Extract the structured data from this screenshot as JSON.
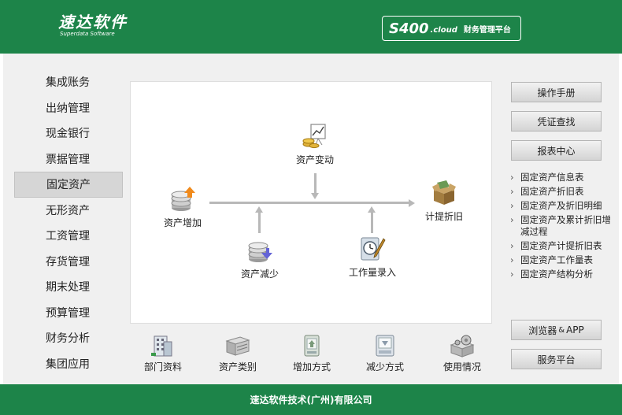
{
  "header": {
    "logo_main": "速达软件",
    "logo_sub": "Superdata Software",
    "product_name": "S400",
    "product_suffix": ".cloud",
    "product_desc": "财务管理平台"
  },
  "nav": {
    "items": [
      {
        "label": "集成账务"
      },
      {
        "label": "出纳管理"
      },
      {
        "label": "现金银行"
      },
      {
        "label": "票据管理"
      },
      {
        "label": "固定资产",
        "active": true
      },
      {
        "label": "无形资产"
      },
      {
        "label": "工资管理"
      },
      {
        "label": "存货管理"
      },
      {
        "label": "期末处理"
      },
      {
        "label": "预算管理"
      },
      {
        "label": "财务分析"
      },
      {
        "label": "集团应用"
      }
    ]
  },
  "flow": {
    "asset_change": "资产变动",
    "asset_increase": "资产增加",
    "depreciation": "计提折旧",
    "asset_decrease": "资产减少",
    "workload_entry": "工作量录入"
  },
  "bottom": {
    "items": [
      {
        "label": "部门资料",
        "icon": "building-icon"
      },
      {
        "label": "资产类别",
        "icon": "server-stack-icon"
      },
      {
        "label": "增加方式",
        "icon": "add-method-icon"
      },
      {
        "label": "减少方式",
        "icon": "reduce-method-icon"
      },
      {
        "label": "使用情况",
        "icon": "gear-box-icon"
      }
    ]
  },
  "right": {
    "manual": "操作手册",
    "voucher": "凭证查找",
    "report_center": "报表中心",
    "reports": [
      "固定资产信息表",
      "固定资产折旧表",
      "固定资产及折旧明细",
      "固定资产及累计折旧增减过程",
      "固定资产计提折旧表",
      "固定资产工作量表",
      "固定资产结构分析"
    ],
    "browser_label": "浏览器",
    "amp": "&",
    "app_label": "APP",
    "service": "服务平台"
  },
  "footer": {
    "company": "速达软件技术(广州)有限公司"
  },
  "colors": {
    "brand_green": "#1d8449",
    "body_bg": "#f0f0f0",
    "connector": "#b8b8b8"
  }
}
